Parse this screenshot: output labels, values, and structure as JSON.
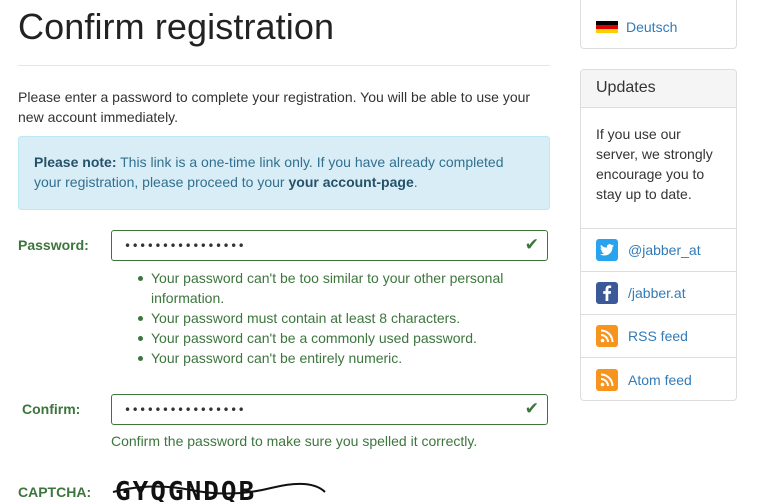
{
  "page": {
    "title": "Confirm registration",
    "intro": "Please enter a password to complete your registration. You will be able to use your new account immediately."
  },
  "alert": {
    "strong": "Please note:",
    "text_before": " This link is a one-time link only. If you have already completed your registration, please proceed to your ",
    "link": "your account-page",
    "text_after": "."
  },
  "form": {
    "password_label": "Password:",
    "password_value": "••••••••••••••••",
    "password_help": [
      "Your password can't be too similar to your other personal information.",
      "Your password must contain at least 8 characters.",
      "Your password can't be a commonly used password.",
      "Your password can't be entirely numeric."
    ],
    "confirm_label": "Confirm:",
    "confirm_value": "••••••••••••••••",
    "confirm_help": "Confirm the password to make sure you spelled it correctly.",
    "captcha_label": "CAPTCHA:",
    "captcha_text": "GYQGNDQB"
  },
  "sidebar": {
    "language": "Deutsch",
    "updates_heading": "Updates",
    "updates_text": "If you use our server, we strongly encourage you to stay up to date.",
    "links": [
      {
        "icon": "twitter-icon",
        "label": "@jabber_at"
      },
      {
        "icon": "facebook-icon",
        "label": "/jabber.at"
      },
      {
        "icon": "rss-icon",
        "label": "RSS feed"
      },
      {
        "icon": "rss-icon",
        "label": "Atom feed"
      }
    ]
  },
  "colors": {
    "success": "#3c763d",
    "info_bg": "#d9edf7",
    "link": "#337ab7"
  }
}
